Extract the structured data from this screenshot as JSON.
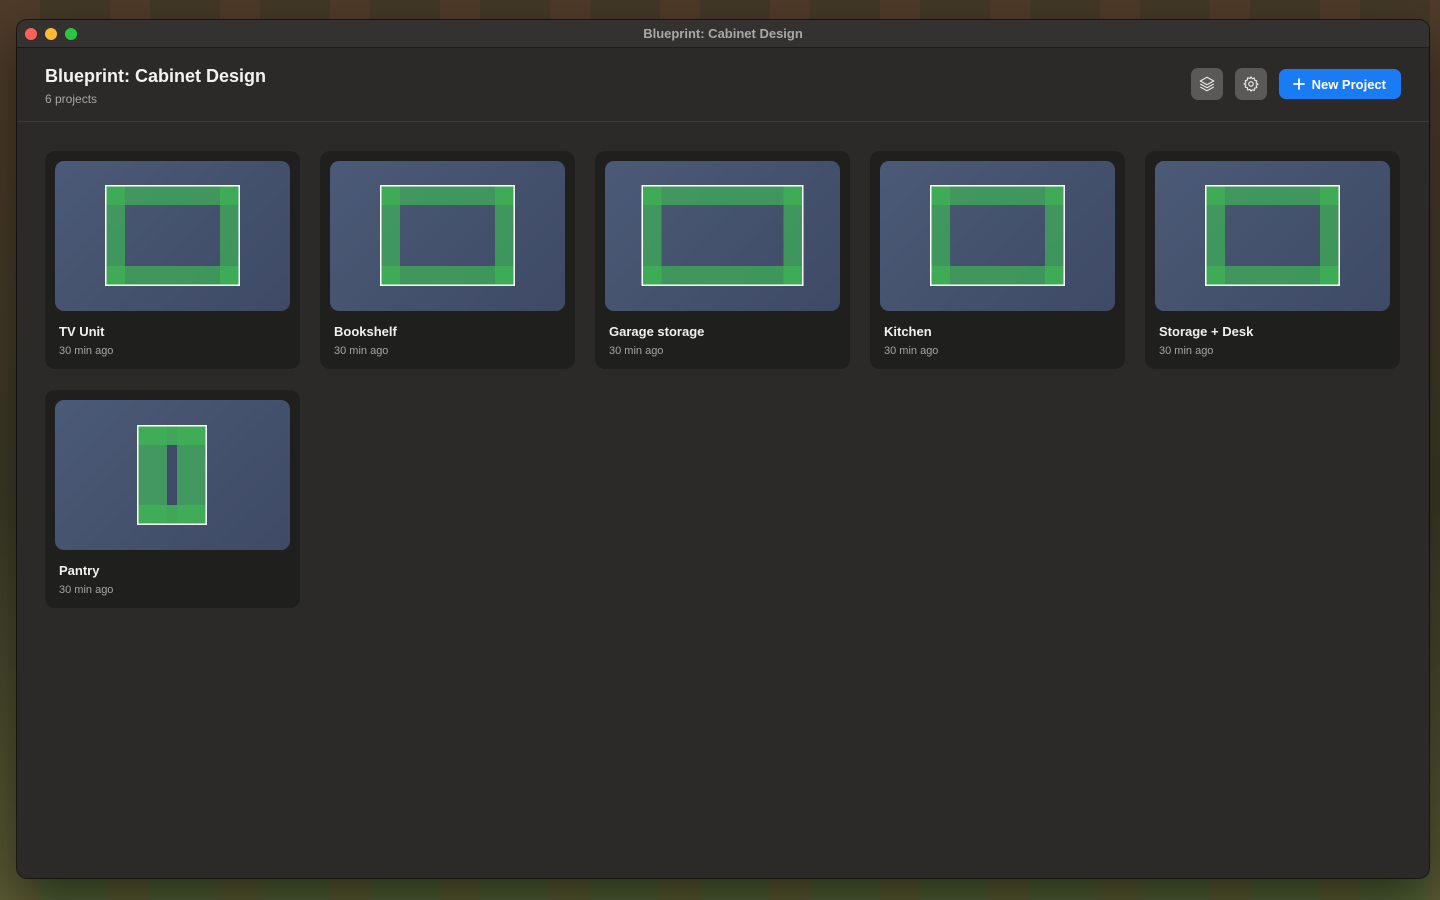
{
  "window": {
    "title": "Blueprint: Cabinet Design"
  },
  "header": {
    "title": "Blueprint: Cabinet Design",
    "subtitle": "6 projects",
    "layers_icon": "layers-icon",
    "settings_icon": "gear-icon",
    "new_project_label": "New Project"
  },
  "colors": {
    "accent": "#1a7cf5",
    "cabinet_green": "#3fae57",
    "thumb_bg": "#46546f"
  },
  "projects": [
    {
      "name": "TV Unit",
      "time": "30 min ago",
      "shape": "wide"
    },
    {
      "name": "Bookshelf",
      "time": "30 min ago",
      "shape": "wide"
    },
    {
      "name": "Garage storage",
      "time": "30 min ago",
      "shape": "wider"
    },
    {
      "name": "Kitchen",
      "time": "30 min ago",
      "shape": "wide"
    },
    {
      "name": "Storage + Desk",
      "time": "30 min ago",
      "shape": "wide"
    },
    {
      "name": "Pantry",
      "time": "30 min ago",
      "shape": "tall"
    }
  ]
}
